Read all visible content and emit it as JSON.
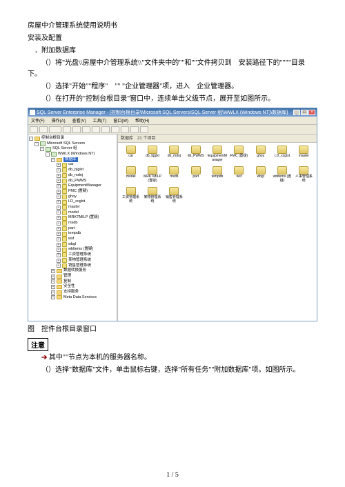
{
  "doc": {
    "title": "房屋中介管理系统使用说明书",
    "section1": "安装及配置",
    "step1": "．附加数据库",
    "step1a": "（）将\"光盘\\\\房屋中介管理系统\\\\\"文件夹中的\"\"和\"\"文件拷贝到　安装路径下的\"\"\"\"目录下。",
    "step1b": "（）选择\"开始\"\"程序\"　\"\" \"企业管理器\"项，进入　企业管理器。",
    "step1c": "（）在打开的\"控制台根目录\"窗口中，连续单击父级节点，展开至如图所示。",
    "caption": "图　控件台根目录窗口",
    "note_label": "注意",
    "note_arrow": "➔",
    "note_text": "其中\"\"节点为本机的服务器名称。",
    "step1d": "（）选择\"数据库\"文件，单击鼠标右键，选择\"所有任务\"\"附加数据库\"项。如图所示。",
    "page_footer": "1 / 5"
  },
  "win": {
    "title": "SQL Server Enterprise Manager - [控制台根目录\\Microsoft SQL Servers\\SQL Server 组\\WWLX (Windows NT)\\数据库]",
    "menu": [
      "文件(F)",
      "操作(A)",
      "查看(V)",
      "工具(T)",
      "窗口(W)",
      "帮助(H)"
    ],
    "content_header": "数据库　21 个项目",
    "tree": [
      {
        "pad": 0,
        "twist": "-",
        "icon": "folder",
        "label": "控制台根目录"
      },
      {
        "pad": 1,
        "twist": "-",
        "icon": "srv",
        "label": "Microsoft SQL Servers"
      },
      {
        "pad": 2,
        "twist": "-",
        "icon": "srv",
        "label": "SQL Server 组"
      },
      {
        "pad": 3,
        "twist": "-",
        "icon": "srv",
        "label": "WWLX (Windows NT)"
      },
      {
        "pad": 4,
        "twist": "-",
        "icon": "folder",
        "label": "数据库",
        "sel": true
      },
      {
        "pad": 5,
        "twist": "+",
        "icon": "db",
        "label": "car"
      },
      {
        "pad": 5,
        "twist": "+",
        "icon": "db",
        "label": "db_bjglxt"
      },
      {
        "pad": 5,
        "twist": "+",
        "icon": "db",
        "label": "db_mdnj"
      },
      {
        "pad": 5,
        "twist": "+",
        "icon": "db",
        "label": "db_PWMS"
      },
      {
        "pad": 5,
        "twist": "+",
        "icon": "db",
        "label": "EquipmentManager"
      },
      {
        "pad": 5,
        "twist": "+",
        "icon": "db",
        "label": "FMC (置疑)"
      },
      {
        "pad": 5,
        "twist": "+",
        "icon": "db",
        "label": "ghoy"
      },
      {
        "pad": 5,
        "twist": "+",
        "icon": "db",
        "label": "LD_xcglxt"
      },
      {
        "pad": 5,
        "twist": "+",
        "icon": "db",
        "label": "master"
      },
      {
        "pad": 5,
        "twist": "+",
        "icon": "db",
        "label": "model"
      },
      {
        "pad": 5,
        "twist": "+",
        "icon": "db",
        "label": "MRKTMILP  (置疑)"
      },
      {
        "pad": 5,
        "twist": "+",
        "icon": "db",
        "label": "msdb"
      },
      {
        "pad": 5,
        "twist": "+",
        "icon": "db",
        "label": "part"
      },
      {
        "pad": 5,
        "twist": "+",
        "icon": "db",
        "label": "tempdb"
      },
      {
        "pad": 5,
        "twist": "+",
        "icon": "db",
        "label": "wsf"
      },
      {
        "pad": 5,
        "twist": "+",
        "icon": "db",
        "label": "wbgl"
      },
      {
        "pad": 5,
        "twist": "+",
        "icon": "db",
        "label": "wbltems (置疑)"
      },
      {
        "pad": 5,
        "twist": "+",
        "icon": "db",
        "label": "工资管理系统"
      },
      {
        "pad": 5,
        "twist": "+",
        "icon": "db",
        "label": "某物管理系统"
      },
      {
        "pad": 5,
        "twist": "+",
        "icon": "db",
        "label": "销售管理系统"
      },
      {
        "pad": 4,
        "twist": "+",
        "icon": "folder",
        "label": "数据转换服务"
      },
      {
        "pad": 4,
        "twist": "+",
        "icon": "folder",
        "label": "管理"
      },
      {
        "pad": 4,
        "twist": "+",
        "icon": "folder",
        "label": "复制"
      },
      {
        "pad": 4,
        "twist": "+",
        "icon": "folder",
        "label": "安全性"
      },
      {
        "pad": 4,
        "twist": "+",
        "icon": "folder",
        "label": "支持服务"
      },
      {
        "pad": 4,
        "twist": "+",
        "icon": "folder",
        "label": "Meta Data Services"
      }
    ],
    "grid": [
      "car",
      "db_bjglxt",
      "db_mdnj",
      "db_PWMS",
      "EquipmentManager",
      "FMC (置疑)",
      "ghoy",
      "LD_xcglxt",
      "master",
      "model",
      "MRKTMILP (置疑)",
      "msdb",
      "part",
      "tempdb",
      "wsf",
      "wbgl",
      "wbltems (置疑)",
      "人事管理系统",
      "工资管理系统",
      "某物管理系统",
      "销售管理系统"
    ]
  }
}
